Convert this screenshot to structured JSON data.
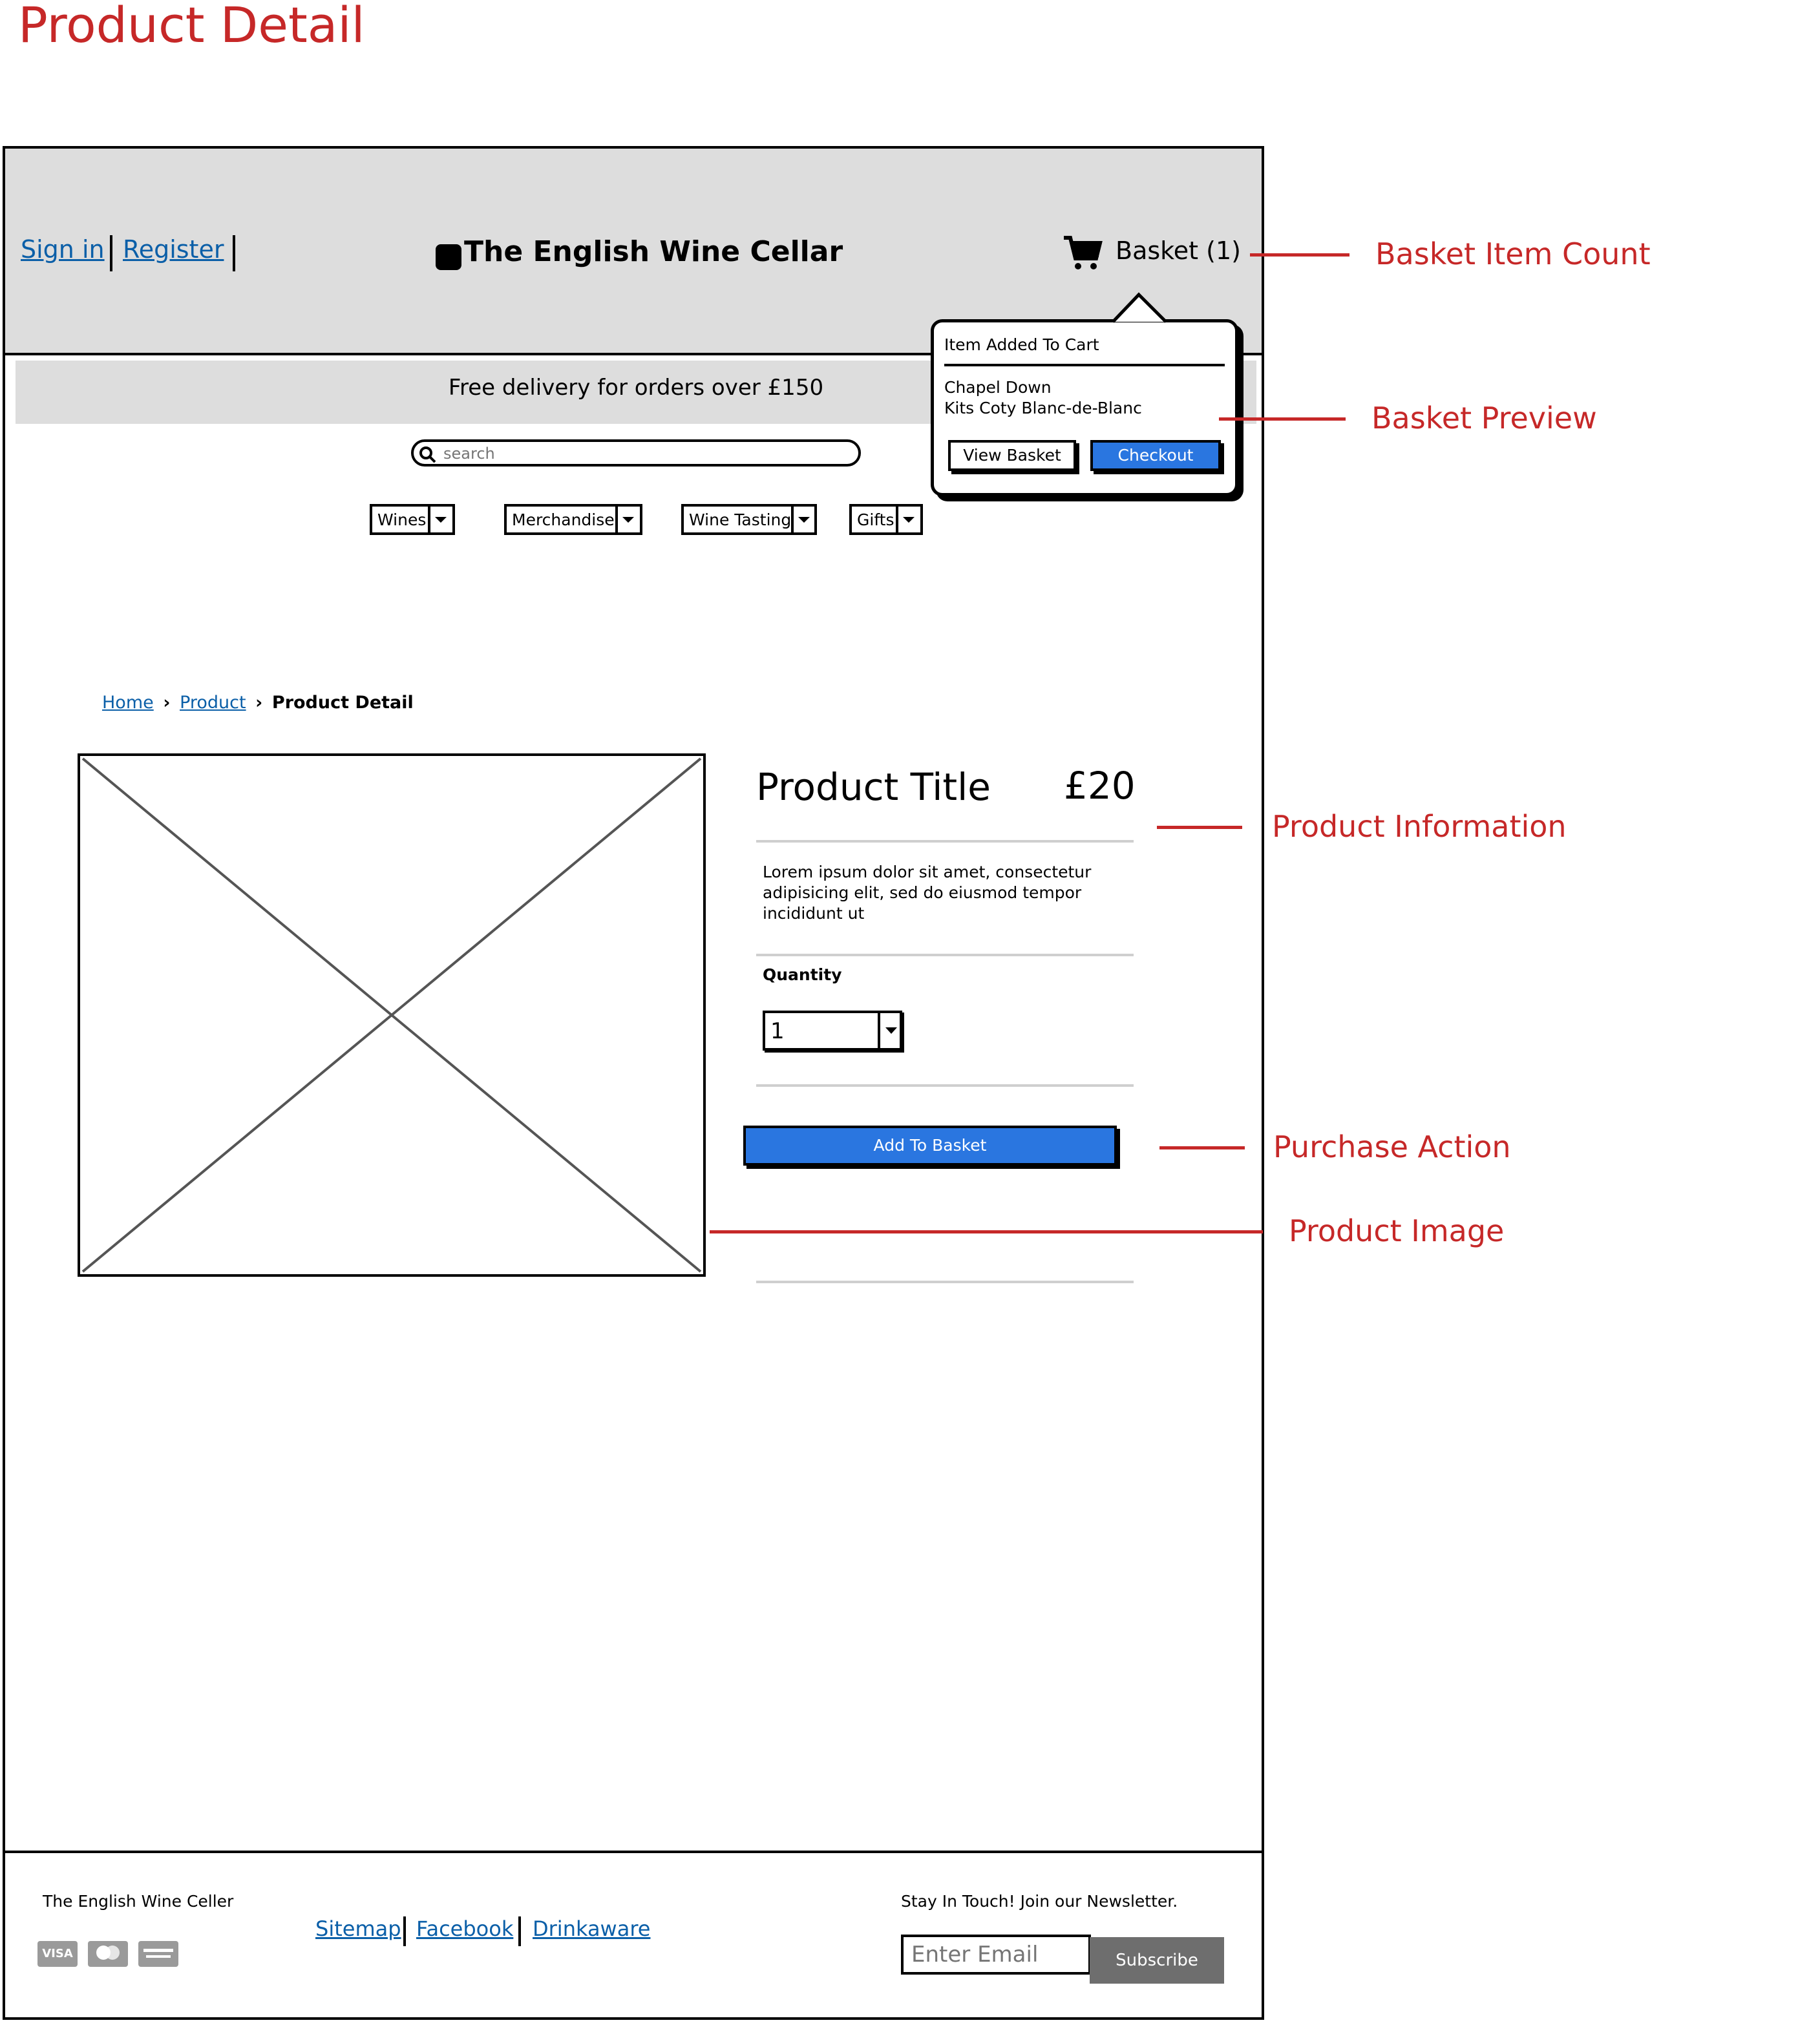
{
  "page": {
    "title": "Product Detail"
  },
  "header": {
    "sign_in": "Sign in",
    "register": "Register",
    "site_name": "The English Wine Cellar",
    "basket_label": "Basket (1)"
  },
  "popup": {
    "heading": "Item Added To Cart",
    "line1": "Chapel Down",
    "line2": "Kits Coty Blanc-de-Blanc",
    "view_basket": "View Basket",
    "checkout": "Checkout"
  },
  "banner": {
    "text": "Free delivery for orders over £150"
  },
  "search": {
    "placeholder": "search"
  },
  "nav": {
    "items": [
      {
        "label": "Wines"
      },
      {
        "label": "Merchandise"
      },
      {
        "label": "Wine Tasting"
      },
      {
        "label": "Gifts"
      }
    ]
  },
  "breadcrumb": {
    "home": "Home",
    "product": "Product",
    "current": "Product Detail"
  },
  "product": {
    "title": "Product Title",
    "price": "£20",
    "description": "Lorem ipsum dolor sit amet, consectetur adipisicing elit, sed do eiusmod tempor incididunt ut",
    "quantity_label": "Quantity",
    "quantity_value": "1",
    "add_to_basket": "Add To Basket"
  },
  "annotations": {
    "basket_item_count": "Basket Item Count",
    "basket_preview": "Basket Preview",
    "product_information": "Product Information",
    "purchase_action": "Purchase Action",
    "product_image": "Product Image"
  },
  "footer": {
    "company": "The English Wine Celler",
    "sitemap": "Sitemap",
    "facebook": "Facebook",
    "drinkaware": "Drinkaware",
    "newsletter_label": "Stay In Touch! Join our Newsletter.",
    "email_placeholder": "Enter Email",
    "subscribe": "Subscribe",
    "cards": [
      "VISA",
      "mastercard-icon",
      "amex-icon"
    ]
  },
  "colors": {
    "accent_blue": "#2a76e0",
    "annotation_red": "#c62828",
    "header_gray": "#dddddd",
    "link_blue": "#0b5fa8"
  }
}
